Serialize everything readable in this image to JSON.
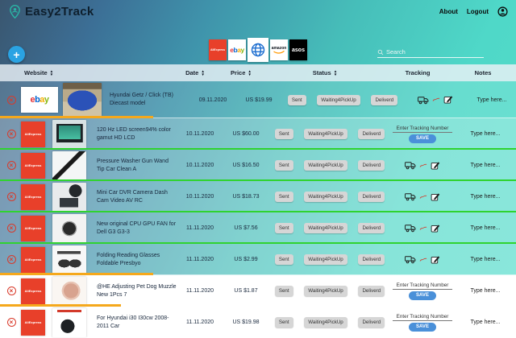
{
  "app": {
    "title": "Easy2Track"
  },
  "nav": {
    "about": "About",
    "logout": "Logout"
  },
  "toolbar": {
    "add_label": "+",
    "search_placeholder": "Search"
  },
  "brands": {
    "aliexpress_label": "AliExpress",
    "ebay_letters": [
      "e",
      "b",
      "a",
      "y"
    ],
    "amazon_label": "amazon",
    "asos_label": "asos"
  },
  "table": {
    "columns": [
      {
        "label": "Website",
        "sortable": true
      },
      {
        "label": "Date",
        "sortable": true
      },
      {
        "label": "Price",
        "sortable": true
      },
      {
        "label": "Status",
        "sortable": true
      },
      {
        "label": "Tracking",
        "sortable": false
      },
      {
        "label": "Notes",
        "sortable": false
      }
    ],
    "status_labels": {
      "sent": "Sent",
      "waiting": "Waiting4PickUp",
      "delivered": "Deliverd"
    },
    "tracking_input": {
      "placeholder": "Enter Tracking Number",
      "save": "SAVE"
    },
    "notes_placeholder": "Type here..."
  },
  "rows": [
    {
      "site": "ebay",
      "thumb": "car-blue",
      "title": "Hyundai Getz / Click (TB) Diecast model",
      "date": "09.11.2020",
      "price": "US $19.99",
      "tracking": "icons",
      "underline": "orange"
    },
    {
      "site": "aliexpress",
      "thumb": "monitor",
      "title": "120 Hz LED screen94% color gamut HD LCD",
      "date": "10.11.2020",
      "price": "US $60.00",
      "tracking": "input",
      "underline": "green"
    },
    {
      "site": "aliexpress",
      "thumb": "wand",
      "title": "Pressure Washer Gun Wand Tip Car Clean A",
      "date": "10.11.2020",
      "price": "US $16.50",
      "tracking": "icons",
      "underline": "green"
    },
    {
      "site": "aliexpress",
      "thumb": "dashcam",
      "title": "Mini Car DVR Camera Dash Cam Video AV RC",
      "date": "10.11.2020",
      "price": "US $18.73",
      "tracking": "icons",
      "underline": "green"
    },
    {
      "site": "aliexpress",
      "thumb": "fan",
      "title": "New original CPU GPU FAN for Dell G3 G3-3",
      "date": "11.11.2020",
      "price": "US $7.56",
      "tracking": "icons",
      "underline": "green"
    },
    {
      "site": "aliexpress",
      "thumb": "glasses",
      "title": "Folding Reading Glasses Foldable Presbyo",
      "date": "11.11.2020",
      "price": "US $2.99",
      "tracking": "icons",
      "underline": "orange"
    },
    {
      "site": "aliexpress",
      "thumb": "muzzle",
      "title": "@HE Adjusting Pet Dog Muzzle New 1Pcs 7",
      "date": "11.11.2020",
      "price": "US $1.87",
      "tracking": "input",
      "underline": "orange-short"
    },
    {
      "site": "aliexpress",
      "thumb": "mudflap",
      "title": "For Hyundai i30 I30cw 2008-2011 Car",
      "date": "11.11.2020",
      "price": "US $19.98",
      "tracking": "input",
      "underline": "none"
    }
  ],
  "colors": {
    "teal": "#4fd8c8",
    "dark_blue": "#3a566f",
    "accent_blue": "#2aa3e3",
    "save_blue": "#4a90d9",
    "aliexpress_red": "#e8402a",
    "line_green": "#2fd32f",
    "line_orange": "#f5a81c"
  }
}
